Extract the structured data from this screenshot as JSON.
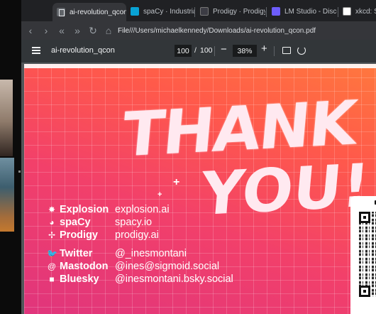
{
  "tabs": [
    {
      "label": "ai-revolution_qcon",
      "active": true,
      "icon": "pdf-icon"
    },
    {
      "label": "spaCy · Industrial-stre",
      "active": false,
      "icon": "spacy-icon"
    },
    {
      "label": "Prodigy · Prodigy · An",
      "active": false,
      "icon": "prodigy-icon"
    },
    {
      "label": "LM Studio - Discover,",
      "active": false,
      "icon": "lmstudio-icon"
    },
    {
      "label": "xkcd: Simpl",
      "active": false,
      "icon": "xkcd-icon"
    }
  ],
  "toolbar": {
    "file_label": "File",
    "url": "///Users/michaelkennedy/Downloads/ai-revolution_qcon.pdf"
  },
  "pdf": {
    "title": "ai-revolution_qcon",
    "current_page": "100",
    "separator": "/",
    "total_pages": "100",
    "zoom": "38%"
  },
  "slide": {
    "headline_1": "THANK",
    "headline_2": "YOU!",
    "links": [
      {
        "icon": "explosion-icon",
        "glyph": "✸",
        "name": "Explosion",
        "value": "explosion.ai"
      },
      {
        "icon": "spacy-icon",
        "glyph": "◕",
        "name": "spaCy",
        "value": "spacy.io"
      },
      {
        "icon": "prodigy-icon",
        "glyph": "✢",
        "name": "Prodigy",
        "value": "prodigy.ai"
      },
      {
        "icon": "twitter-icon",
        "glyph": "🐦",
        "name": "Twitter",
        "value": "@_inesmontani"
      },
      {
        "icon": "mastodon-icon",
        "glyph": "@",
        "name": "Mastodon",
        "value": "@ines@sigmoid.social"
      },
      {
        "icon": "bluesky-icon",
        "glyph": "■",
        "name": "Bluesky",
        "value": "@inesmontani.bsky.social"
      }
    ]
  },
  "colors": {
    "chrome_bg": "#202124",
    "pdf_toolbar": "#323639",
    "slide_orange": "#ff7a3d",
    "slide_pink": "#e0357c"
  }
}
